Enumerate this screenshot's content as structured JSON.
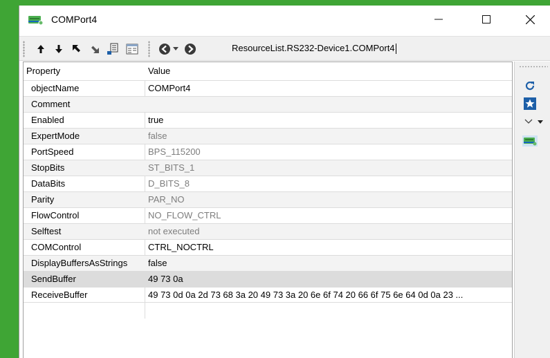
{
  "window": {
    "title": "COMPort4",
    "minimize_icon": "minimize-icon",
    "maximize_icon": "maximize-icon",
    "close_icon": "close-icon"
  },
  "toolbar": {
    "buttons": [
      "move-up-icon",
      "move-down-icon",
      "move-top-icon",
      "move-bottom-icon",
      "insert-icon",
      "properties-icon",
      "back-icon",
      "history-dropdown-icon",
      "forward-icon"
    ],
    "address": "ResourceList.RS232-Device1.COMPort4"
  },
  "table": {
    "headers": {
      "property": "Property",
      "value": "Value"
    },
    "rows": [
      {
        "property": "objectName",
        "value": "COMPort4"
      },
      {
        "property": "Comment",
        "value": ""
      },
      {
        "property": "Enabled",
        "value": "true"
      },
      {
        "property": "ExpertMode",
        "value": "false"
      },
      {
        "property": "PortSpeed",
        "value": "BPS_115200"
      },
      {
        "property": "StopBits",
        "value": "ST_BITS_1"
      },
      {
        "property": "DataBits",
        "value": "D_BITS_8"
      },
      {
        "property": "Parity",
        "value": "PAR_NO"
      },
      {
        "property": "FlowControl",
        "value": "NO_FLOW_CTRL"
      },
      {
        "property": "Selftest",
        "value": "not executed"
      },
      {
        "property": "COMControl",
        "value": "CTRL_NOCTRL"
      },
      {
        "property": "DisplayBuffersAsStrings",
        "value": "false"
      },
      {
        "property": "SendBuffer",
        "value": "49 73 0a"
      },
      {
        "property": "ReceiveBuffer",
        "value": "49 73 0d 0a 2d 73 68 3a 20 49 73 3a 20 6e 6f 74 20 66 6f 75 6e 64 0d 0a 23 ..."
      }
    ]
  },
  "sidebar": {
    "buttons": [
      "refresh-icon",
      "favorite-star-icon",
      "more-dropdown-icon",
      "device-icon"
    ]
  },
  "colors": {
    "background_green": "#3fa535",
    "accent_blue": "#1d5fa8",
    "device_green": "#4caf50"
  }
}
